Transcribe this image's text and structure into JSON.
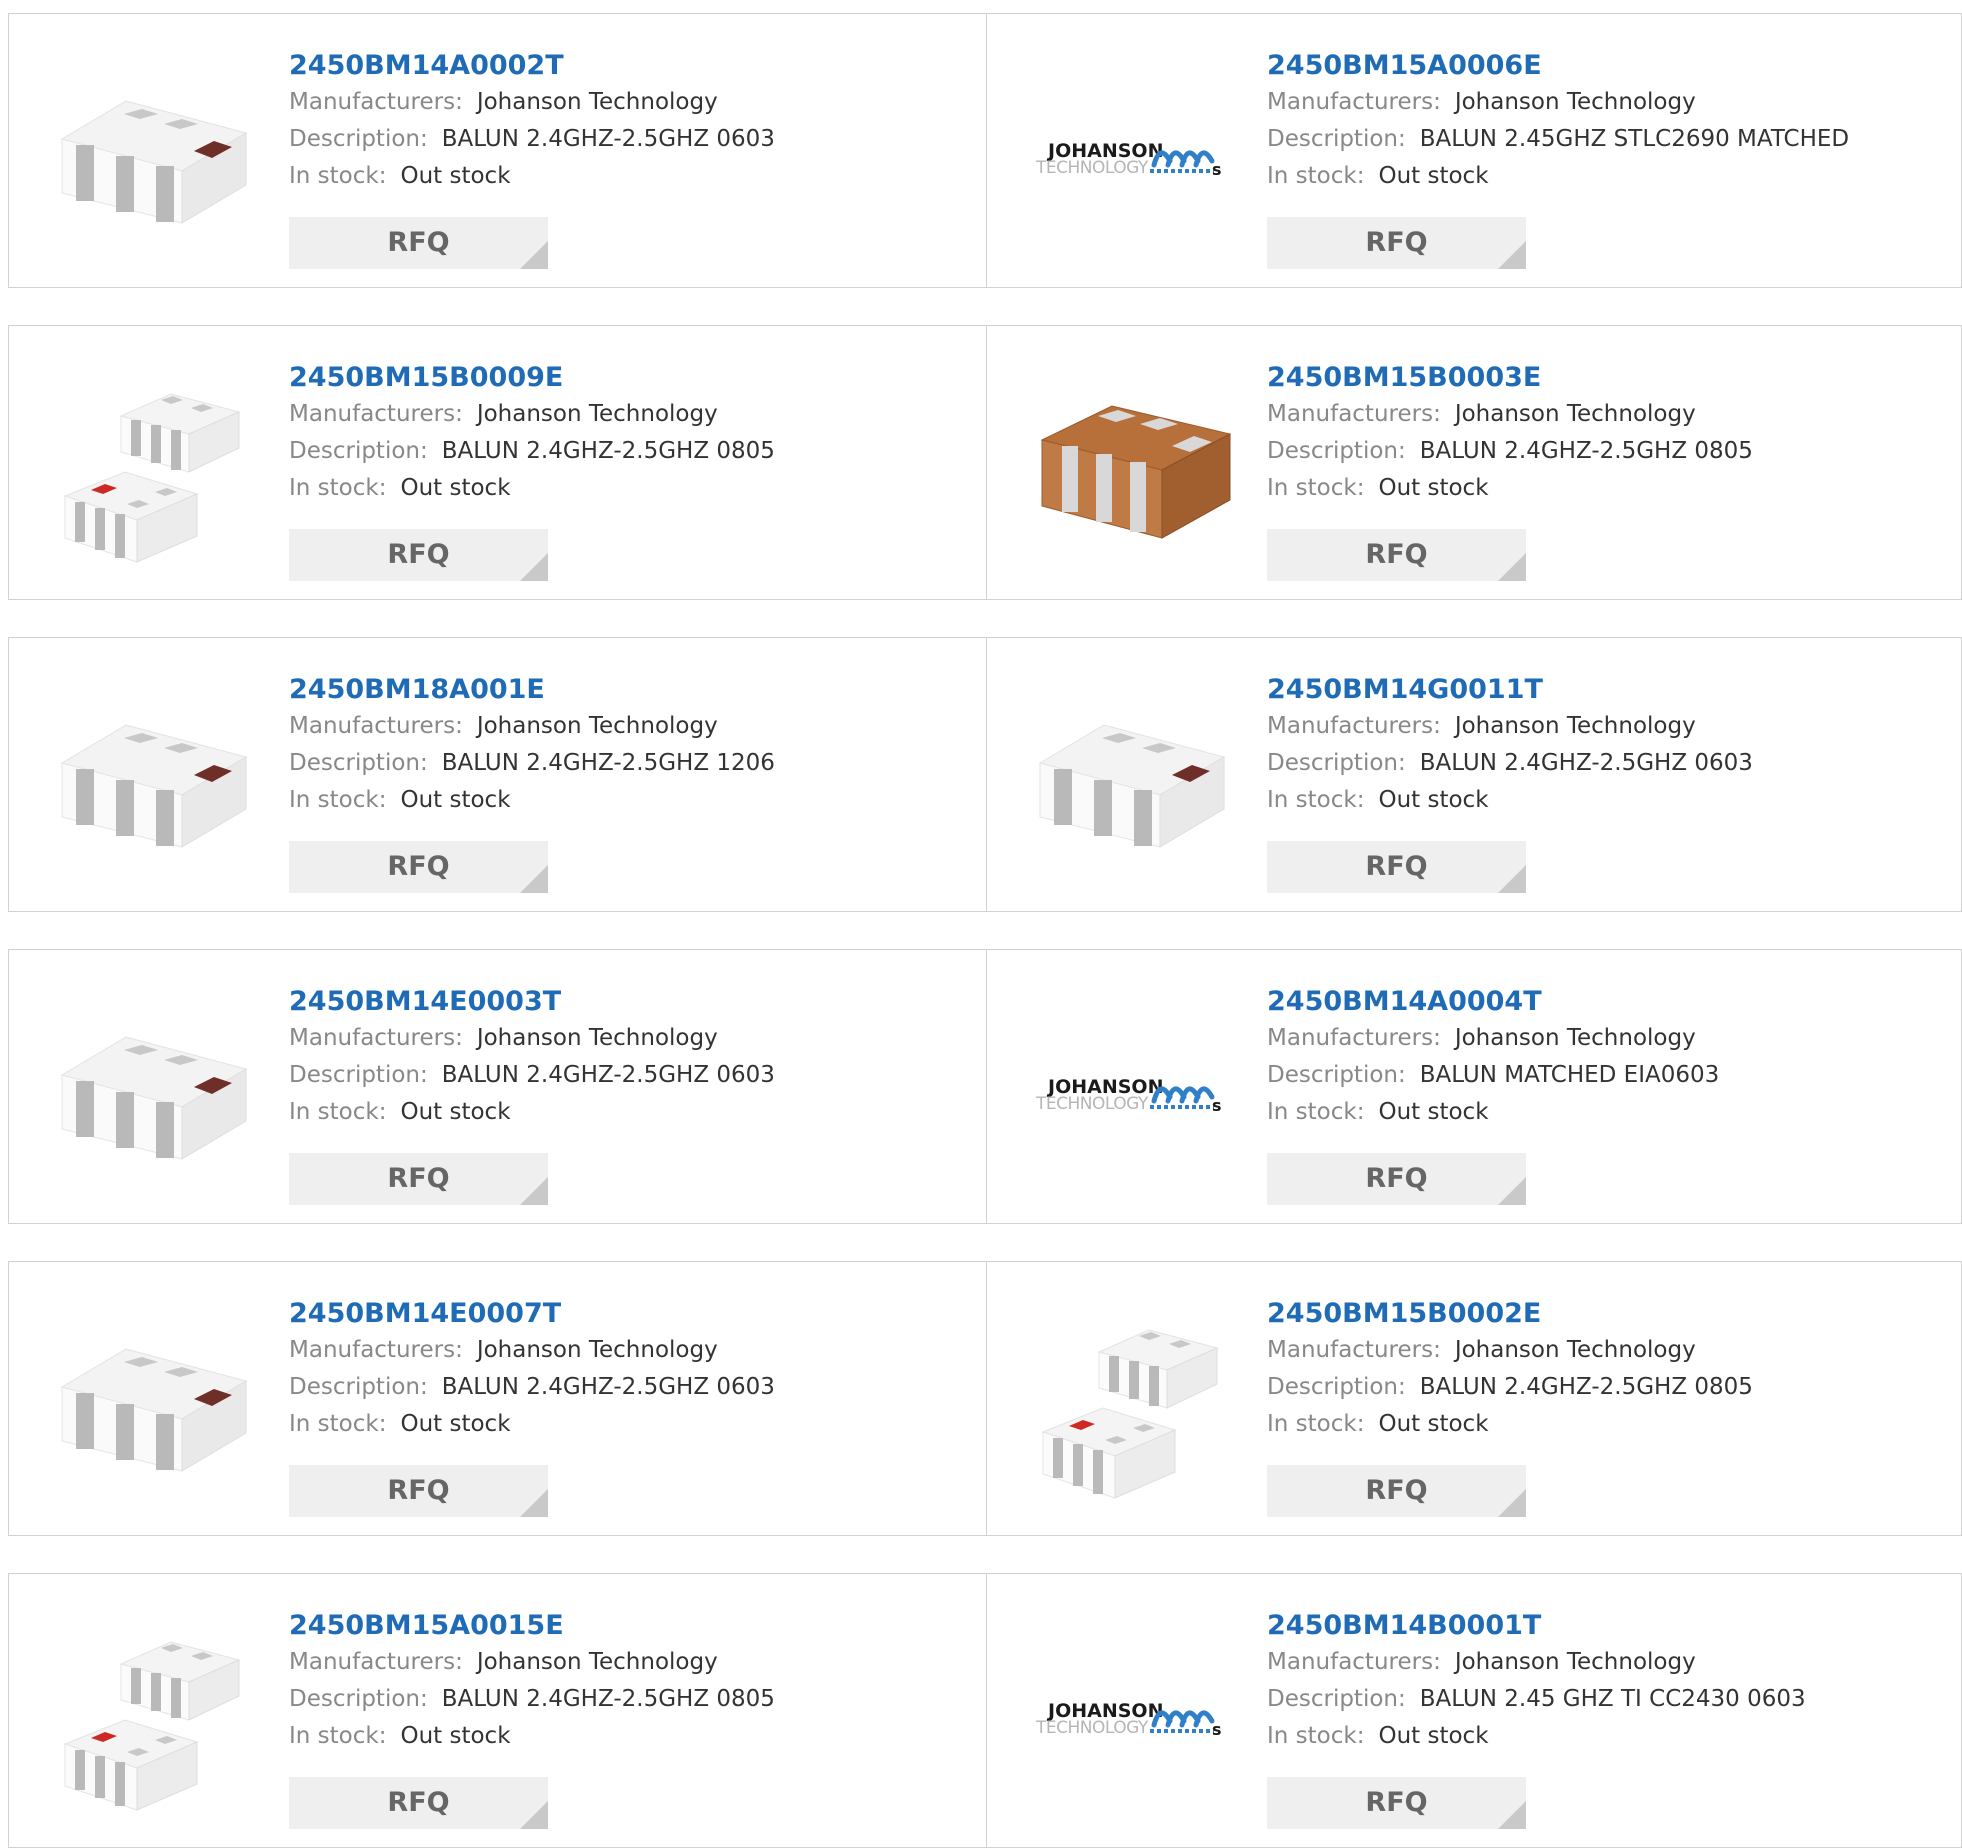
{
  "labels": {
    "manufacturers": "Manufacturers:",
    "description": "Description:",
    "in_stock": "In stock:",
    "rfq": "RFQ"
  },
  "colors": {
    "part_number": "#1f6bb5",
    "label": "#888888",
    "value": "#333333",
    "button_bg": "#efefef",
    "button_text": "#666666",
    "border": "#d2d2d2"
  },
  "products": [
    {
      "part_number": "2450BM14A0002T",
      "manufacturer": "Johanson Technology",
      "description": "BALUN 2.4GHZ-2.5GHZ 0603",
      "stock": "Out stock",
      "image": "white-chip"
    },
    {
      "part_number": "2450BM15A0006E",
      "manufacturer": "Johanson Technology",
      "description": "BALUN 2.45GHZ STLC2690 MATCHED",
      "stock": "Out stock",
      "image": "johanson-logo"
    },
    {
      "part_number": "2450BM15B0009E",
      "manufacturer": "Johanson Technology",
      "description": "BALUN 2.4GHZ-2.5GHZ 0805",
      "stock": "Out stock",
      "image": "chip-pair"
    },
    {
      "part_number": "2450BM15B0003E",
      "manufacturer": "Johanson Technology",
      "description": "BALUN 2.4GHZ-2.5GHZ 0805",
      "stock": "Out stock",
      "image": "brown-chip"
    },
    {
      "part_number": "2450BM18A001E",
      "manufacturer": "Johanson Technology",
      "description": "BALUN 2.4GHZ-2.5GHZ 1206",
      "stock": "Out stock",
      "image": "white-chip"
    },
    {
      "part_number": "2450BM14G0011T",
      "manufacturer": "Johanson Technology",
      "description": "BALUN 2.4GHZ-2.5GHZ 0603",
      "stock": "Out stock",
      "image": "white-chip"
    },
    {
      "part_number": "2450BM14E0003T",
      "manufacturer": "Johanson Technology",
      "description": "BALUN 2.4GHZ-2.5GHZ 0603",
      "stock": "Out stock",
      "image": "white-chip"
    },
    {
      "part_number": "2450BM14A0004T",
      "manufacturer": "Johanson Technology",
      "description": "BALUN MATCHED EIA0603",
      "stock": "Out stock",
      "image": "johanson-logo"
    },
    {
      "part_number": "2450BM14E0007T",
      "manufacturer": "Johanson Technology",
      "description": "BALUN 2.4GHZ-2.5GHZ 0603",
      "stock": "Out stock",
      "image": "white-chip"
    },
    {
      "part_number": "2450BM15B0002E",
      "manufacturer": "Johanson Technology",
      "description": "BALUN 2.4GHZ-2.5GHZ 0805",
      "stock": "Out stock",
      "image": "chip-pair"
    },
    {
      "part_number": "2450BM15A0015E",
      "manufacturer": "Johanson Technology",
      "description": "BALUN 2.4GHZ-2.5GHZ 0805",
      "stock": "Out stock",
      "image": "chip-pair"
    },
    {
      "part_number": "2450BM14B0001T",
      "manufacturer": "Johanson Technology",
      "description": "BALUN 2.45 GHZ TI CC2430 0603",
      "stock": "Out stock",
      "image": "johanson-logo"
    }
  ],
  "logo_text": {
    "line1": "JOHANSON",
    "line2": "TECHNOLOGY"
  }
}
